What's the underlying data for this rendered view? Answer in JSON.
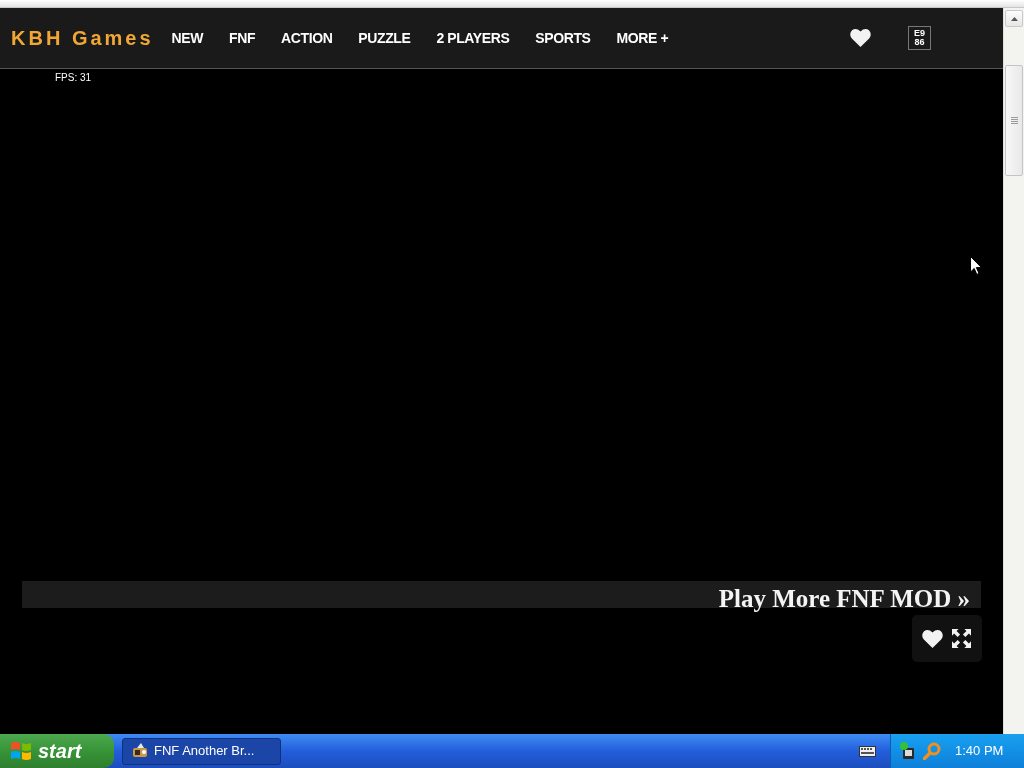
{
  "header": {
    "logo": "KBH Games",
    "nav": [
      "NEW",
      "FNF",
      "ACTION",
      "PUZZLE",
      "2 PLAYERS",
      "SPORTS",
      "MORE +"
    ],
    "glyph_box": [
      "E9",
      "86"
    ]
  },
  "game": {
    "fps": "FPS: 31",
    "banner": "Play More FNF MOD »"
  },
  "taskbar": {
    "start": "start",
    "tasks": [
      {
        "label": "FNF Another Br...",
        "selected": true
      }
    ],
    "clock": "1:40 PM"
  }
}
